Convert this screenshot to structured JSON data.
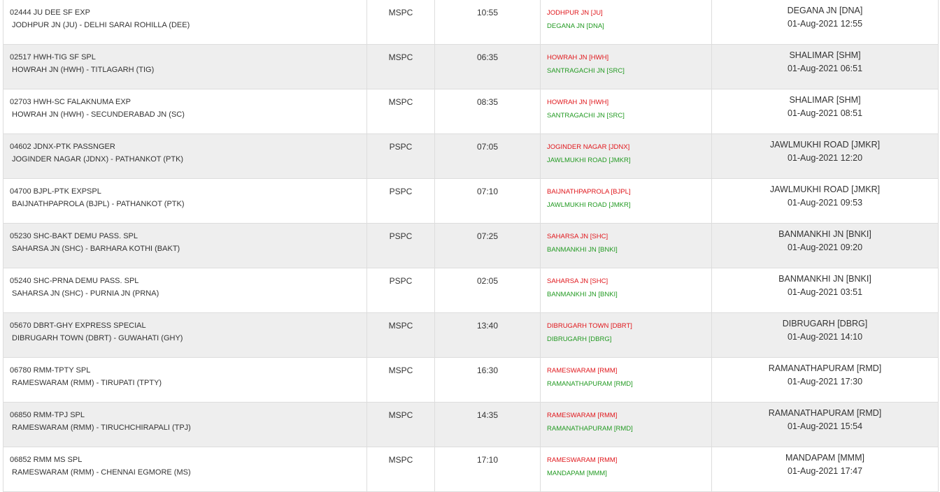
{
  "rows": [
    {
      "train": "02444 JU DEE SF EXP",
      "route": "JODHPUR JN (JU) - DELHI SARAI ROHILLA (DEE)",
      "type": "MSPC",
      "time": "10:55",
      "from": "JODHPUR JN [JU]",
      "to": "DEGANA JN [DNA]",
      "dest": "DEGANA JN [DNA]",
      "datetime": "01-Aug-2021 12:55"
    },
    {
      "train": "02517 HWH-TIG SF SPL",
      "route": "HOWRAH JN (HWH) - TITLAGARH (TIG)",
      "type": "MSPC",
      "time": "06:35",
      "from": "HOWRAH JN [HWH]",
      "to": "SANTRAGACHI JN [SRC]",
      "dest": "SHALIMAR [SHM]",
      "datetime": "01-Aug-2021 06:51"
    },
    {
      "train": "02703 HWH-SC FALAKNUMA EXP",
      "route": "HOWRAH JN (HWH) - SECUNDERABAD JN (SC)",
      "type": "MSPC",
      "time": "08:35",
      "from": "HOWRAH JN [HWH]",
      "to": "SANTRAGACHI JN [SRC]",
      "dest": "SHALIMAR [SHM]",
      "datetime": "01-Aug-2021 08:51"
    },
    {
      "train": "04602 JDNX-PTK PASSNGER",
      "route": "JOGINDER NAGAR (JDNX) - PATHANKOT (PTK)",
      "type": "PSPC",
      "time": "07:05",
      "from": "JOGINDER NAGAR [JDNX]",
      "to": "JAWLMUKHI ROAD [JMKR]",
      "dest": "JAWLMUKHI ROAD [JMKR]",
      "datetime": "01-Aug-2021 12:20"
    },
    {
      "train": "04700 BJPL-PTK EXPSPL",
      "route": "BAIJNATHPAPROLA (BJPL) - PATHANKOT (PTK)",
      "type": "PSPC",
      "time": "07:10",
      "from": "BAIJNATHPAPROLA [BJPL]",
      "to": "JAWLMUKHI ROAD [JMKR]",
      "dest": "JAWLMUKHI ROAD [JMKR]",
      "datetime": "01-Aug-2021 09:53"
    },
    {
      "train": "05230 SHC-BAKT DEMU PASS. SPL",
      "route": "SAHARSA JN (SHC) - BARHARA KOTHI (BAKT)",
      "type": "PSPC",
      "time": "07:25",
      "from": "SAHARSA JN [SHC]",
      "to": "BANMANKHI JN [BNKI]",
      "dest": "BANMANKHI JN [BNKI]",
      "datetime": "01-Aug-2021 09:20"
    },
    {
      "train": "05240 SHC-PRNA DEMU PASS. SPL",
      "route": "SAHARSA JN (SHC) - PURNIA JN (PRNA)",
      "type": "PSPC",
      "time": "02:05",
      "from": "SAHARSA JN [SHC]",
      "to": "BANMANKHI JN [BNKI]",
      "dest": "BANMANKHI JN [BNKI]",
      "datetime": "01-Aug-2021 03:51"
    },
    {
      "train": "05670 DBRT-GHY EXPRESS SPECIAL",
      "route": "DIBRUGARH TOWN (DBRT) - GUWAHATI (GHY)",
      "type": "MSPC",
      "time": "13:40",
      "from": "DIBRUGARH TOWN [DBRT]",
      "to": "DIBRUGARH [DBRG]",
      "dest": "DIBRUGARH [DBRG]",
      "datetime": "01-Aug-2021 14:10"
    },
    {
      "train": "06780 RMM-TPTY SPL",
      "route": "RAMESWARAM (RMM) - TIRUPATI (TPTY)",
      "type": "MSPC",
      "time": "16:30",
      "from": "RAMESWARAM [RMM]",
      "to": "RAMANATHAPURAM [RMD]",
      "dest": "RAMANATHAPURAM [RMD]",
      "datetime": "01-Aug-2021 17:30"
    },
    {
      "train": "06850 RMM-TPJ SPL",
      "route": "RAMESWARAM (RMM) - TIRUCHCHIRAPALI (TPJ)",
      "type": "MSPC",
      "time": "14:35",
      "from": "RAMESWARAM [RMM]",
      "to": "RAMANATHAPURAM [RMD]",
      "dest": "RAMANATHAPURAM [RMD]",
      "datetime": "01-Aug-2021 15:54"
    },
    {
      "train": "06852 RMM MS SPL",
      "route": "RAMESWARAM (RMM) - CHENNAI EGMORE (MS)",
      "type": "MSPC",
      "time": "17:10",
      "from": "RAMESWARAM [RMM]",
      "to": "MANDAPAM [MMM]",
      "dest": "MANDAPAM [MMM]",
      "datetime": "01-Aug-2021 17:47"
    }
  ],
  "colors": {
    "from": "#e0161b",
    "to": "#229a22",
    "alt_row": "#eeeeee",
    "border": "#dddddd"
  }
}
